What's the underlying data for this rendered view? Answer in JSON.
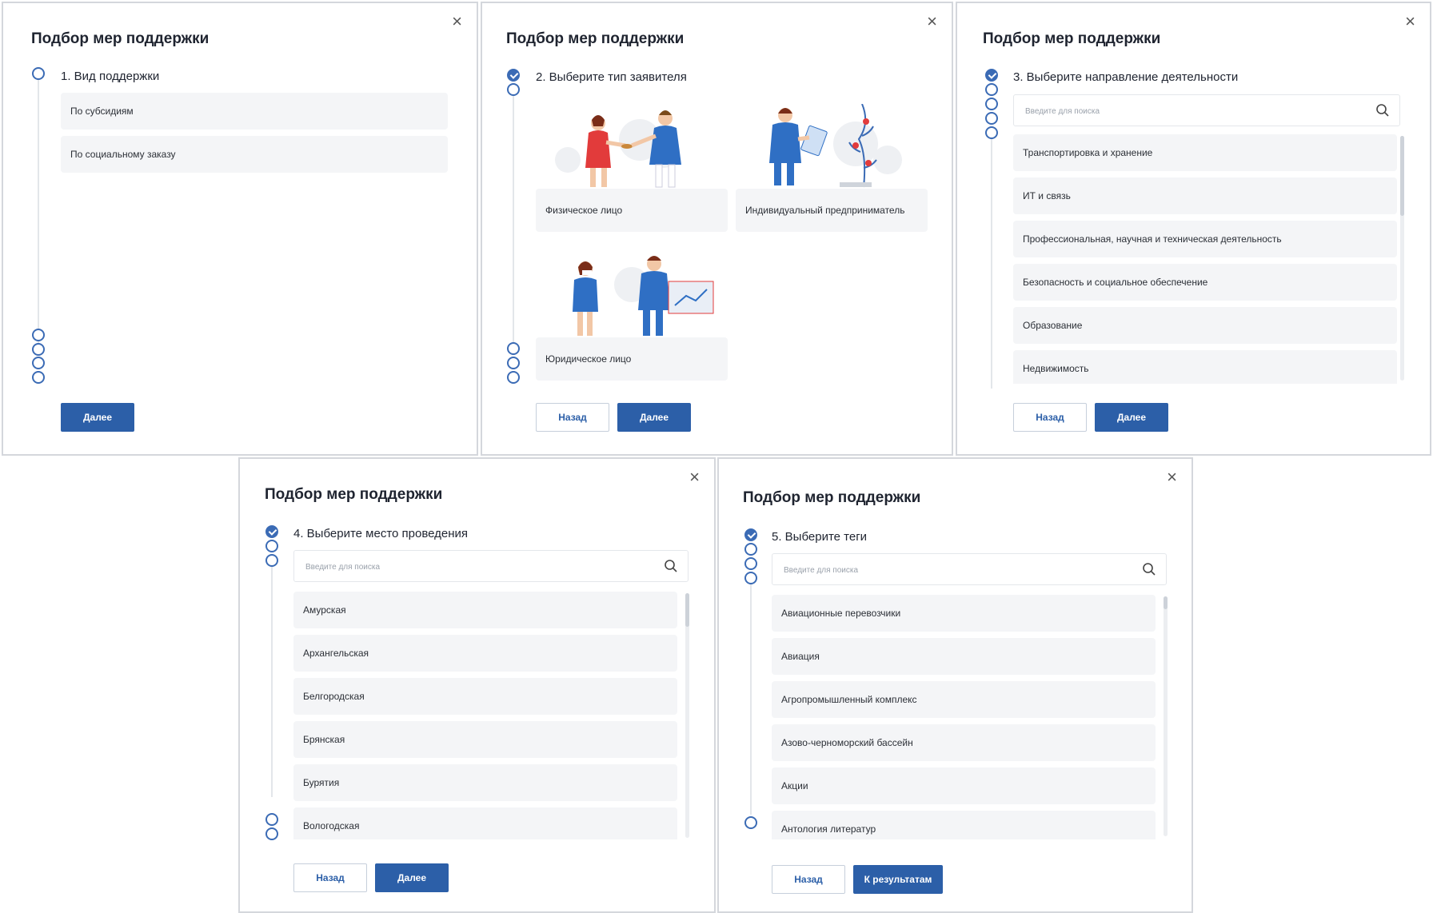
{
  "title": "Подбор мер поддержки",
  "close_glyph": "×",
  "search_placeholder": "Введите для поиска",
  "buttons": {
    "back": "Назад",
    "next": "Далее",
    "results": "К результатам"
  },
  "step1": {
    "title": "1. Вид поддержки",
    "options": [
      "По субсидиям",
      "По социальному заказу"
    ]
  },
  "step2": {
    "title": "2. Выберите тип заявителя",
    "options": [
      "Физическое лицо",
      "Индивидуальный предприниматель",
      "Юридическое лицо"
    ]
  },
  "step3": {
    "title": "3. Выберите направление деятельности",
    "options": [
      "Транспортировка и хранение",
      "ИТ и связь",
      "Профессиональная, научная и техническая деятельность",
      "Безопасность и социальное обеспечение",
      "Образование",
      "Недвижимость"
    ]
  },
  "step4": {
    "title": "4. Выберите место проведения",
    "options": [
      "Амурская",
      "Архангельская",
      "Белгородская",
      "Брянская",
      "Бурятия",
      "Вологодская"
    ]
  },
  "step5": {
    "title": "5. Выберите теги",
    "options": [
      "Авиационные перевозчики",
      "Авиация",
      "Агропромышленный комплекс",
      "Азово-черноморский бассейн",
      "Акции",
      "Антология литератур"
    ]
  },
  "colors": {
    "primary": "#2c5fa8",
    "stepper": "#3b6bb5",
    "option_bg": "#f4f5f7",
    "accent_red": "#e23b3b"
  },
  "icons": {
    "close": "close-icon",
    "search": "search-icon",
    "step_done": "check-circle-icon",
    "step_pending": "circle-icon"
  }
}
